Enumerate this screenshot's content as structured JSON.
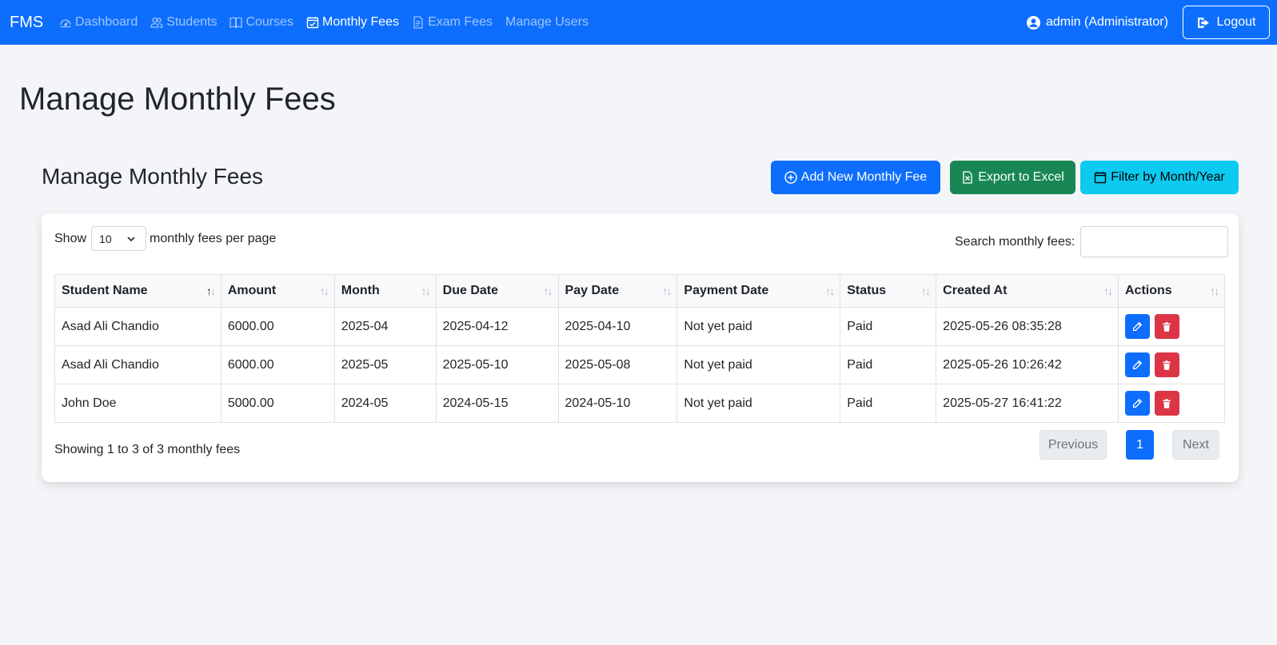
{
  "nav": {
    "brand": "FMS",
    "links": [
      {
        "label": "Dashboard",
        "icon": "speedometer-icon"
      },
      {
        "label": "Students",
        "icon": "people-icon"
      },
      {
        "label": "Courses",
        "icon": "book-icon"
      },
      {
        "label": "Monthly Fees",
        "icon": "calendar-check-icon",
        "active": true
      },
      {
        "label": "Exam Fees",
        "icon": "file-text-icon"
      },
      {
        "label": "Manage Users",
        "icon": ""
      }
    ],
    "user": "admin (Administrator)",
    "logout_label": "Logout"
  },
  "page": {
    "title": "Manage Monthly Fees",
    "section_title": "Manage Monthly Fees"
  },
  "actions": {
    "add_label": "Add New Monthly Fee",
    "export_label": "Export to Excel",
    "filter_label": "Filter by Month/Year"
  },
  "table_controls": {
    "show_label": "Show",
    "page_size": "10",
    "per_page_label": "monthly fees per page",
    "search_label": "Search monthly fees:",
    "search_value": ""
  },
  "table": {
    "columns": [
      "Student Name",
      "Amount",
      "Month",
      "Due Date",
      "Pay Date",
      "Payment Date",
      "Status",
      "Created At",
      "Actions"
    ],
    "rows": [
      [
        "Asad Ali Chandio",
        "6000.00",
        "2025-04",
        "2025-04-12",
        "2025-04-10",
        "Not yet paid",
        "Paid",
        "2025-05-26 08:35:28"
      ],
      [
        "Asad Ali Chandio",
        "6000.00",
        "2025-05",
        "2025-05-10",
        "2025-05-08",
        "Not yet paid",
        "Paid",
        "2025-05-26 10:26:42"
      ],
      [
        "John Doe",
        "5000.00",
        "2024-05",
        "2024-05-15",
        "2024-05-10",
        "Not yet paid",
        "Paid",
        "2025-05-27 16:41:22"
      ]
    ]
  },
  "footer": {
    "info": "Showing 1 to 3 of 3 monthly fees",
    "previous": "Previous",
    "current_page": "1",
    "next": "Next"
  },
  "colors": {
    "primary": "#0d6efd",
    "success": "#198754",
    "info": "#0dcaf0",
    "danger": "#dc3545"
  }
}
